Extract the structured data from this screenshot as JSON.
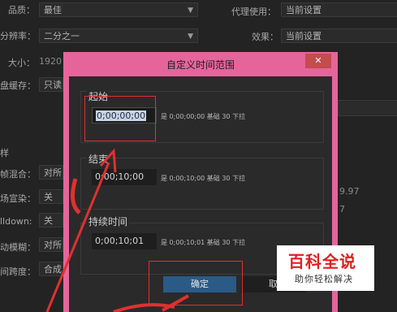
{
  "background": {
    "left_rows": [
      {
        "label": "品质：",
        "value": "最佳"
      },
      {
        "label": "分辨率：",
        "value": "二分之一"
      },
      {
        "label": "大小：",
        "value": "1920 x"
      },
      {
        "label": "盘缓存：",
        "value": "只读"
      },
      {
        "label": "样",
        "value": ""
      },
      {
        "label": "帧混合：",
        "value": "对所"
      },
      {
        "label": "场宣染：",
        "value": "关"
      },
      {
        "label": "lldown:",
        "value": "关"
      },
      {
        "label": "动模糊：",
        "value": "对所"
      },
      {
        "label": "间跨度：",
        "value": "合成"
      }
    ],
    "right_rows": [
      {
        "label": "代理使用：",
        "value": "当前设置"
      },
      {
        "label": "效果：",
        "value": "当前设置"
      }
    ],
    "faint_values": [
      "9.97",
      "7"
    ]
  },
  "dialog": {
    "title": "自定义时间范围",
    "close_label": "✕",
    "groups": [
      {
        "label": "起始",
        "timecode": "0;00;00;00",
        "info": "是 0;00;00;00  基础 30  下拉"
      },
      {
        "label": "结束",
        "timecode": "0;00;10;00",
        "info": "是 0;00;10;00  基础 30  下拉"
      },
      {
        "label": "持续时间",
        "timecode": "0;00;10;01",
        "info": "是 0;00;10;01  基础 30  下拉"
      }
    ],
    "ok_label": "确定",
    "cancel_label": "取"
  },
  "watermark": {
    "title": "百科全说",
    "subtitle": "助你轻松解决"
  },
  "colors": {
    "dialog_border": "#e5659b",
    "ok_button": "#2a5a86",
    "annotation": "#e03030"
  }
}
